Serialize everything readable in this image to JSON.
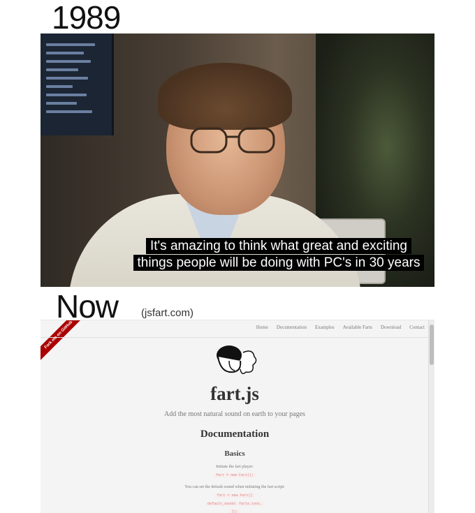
{
  "top_label": "1989",
  "photo": {
    "subtitle_line1": "It's amazing to think what great and exciting",
    "subtitle_line2": "things people will be doing with PC's in 30 years"
  },
  "bottom_label": "Now",
  "bottom_url": "(jsfart.com)",
  "site": {
    "ribbon": "Fork me on GitHub",
    "nav": [
      "Home",
      "Documentation",
      "Examples",
      "Available Farts",
      "Download",
      "Contact"
    ],
    "title": "fart.js",
    "tagline": "Add the most natural sound on earth to your pages",
    "doc_heading": "Documentation",
    "basics_heading": "Basics",
    "text1": "Initiate the fart player:",
    "code1": "fart = new Fart();",
    "text2": "You can set the default sound when initiating the fart script:",
    "code2": "fart = new Fart({",
    "code3": "default_sound: farts.toot,",
    "code4": "});"
  },
  "colors": {
    "ribbon": "#aa0000",
    "code": "#d58686"
  }
}
